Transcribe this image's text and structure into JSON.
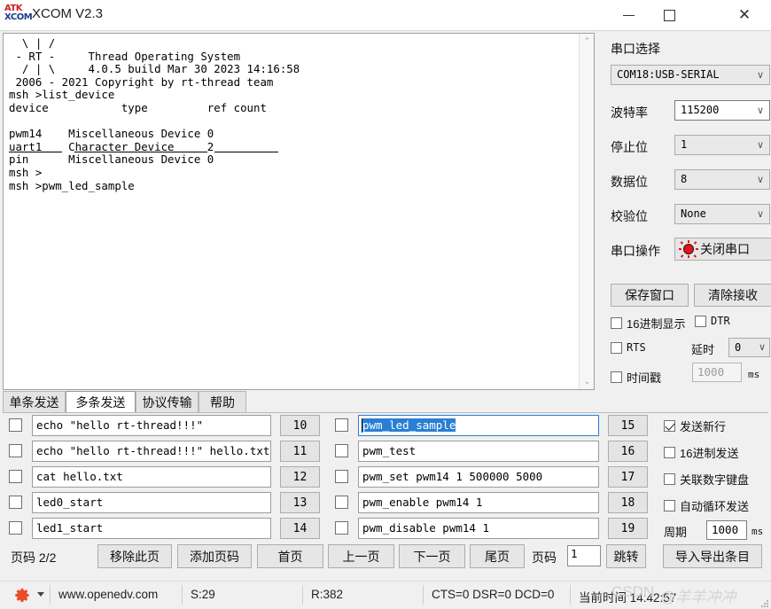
{
  "window": {
    "title": "XCOM V2.3",
    "logo_line1": "ATK",
    "logo_line2": "XCOM",
    "minimize_label": "—",
    "maximize_label": "☐",
    "close_label": "✕"
  },
  "terminal": {
    "text": "  \\ | /\n - RT -     Thread Operating System\n  / | \\     4.0.5 build Mar 30 2023 14:16:58\n 2006 - 2021 Copyright by rt-thread team\nmsh >list_device\ndevice           type         ref count\n\npwm14    Miscellaneous Device 0\nuart1    Character Device     2\npin      Miscellaneous Device 0\nmsh >\nmsh >pwm_led_sample",
    "scroll_up_icon": "⌃",
    "scroll_down_icon": "⌄"
  },
  "panel": {
    "port_section_label": "串口选择",
    "port_value": "COM18:USB-SERIAL",
    "fields": [
      {
        "label": "波特率",
        "value": "115200"
      },
      {
        "label": "停止位",
        "value": "1"
      },
      {
        "label": "数据位",
        "value": "8"
      },
      {
        "label": "校验位",
        "value": "None"
      }
    ],
    "operation_label": "串口操作",
    "close_port_label": "关闭串口",
    "save_window_label": "保存窗口",
    "clear_receive_label": "清除接收",
    "hex_display_label": "16进制显示",
    "hex_display_checked": false,
    "dtr_label": "DTR",
    "dtr_checked": false,
    "rts_label": "RTS",
    "rts_checked": false,
    "delay_label": "延时",
    "delay_value": "0",
    "timestamp_label": "时间戳",
    "timestamp_checked": false,
    "timestamp_value": "1000",
    "timestamp_unit": "ms",
    "chevron": "∨",
    "accent_red": "#e81313"
  },
  "tabs": [
    {
      "label": "单条发送",
      "active": false
    },
    {
      "label": "多条发送",
      "active": true
    },
    {
      "label": "协议传输",
      "active": false
    },
    {
      "label": "帮助",
      "active": false
    }
  ],
  "commands_left": [
    {
      "checked": false,
      "text": "echo \"hello rt-thread!!!\"",
      "num": "10"
    },
    {
      "checked": false,
      "text": "echo \"hello rt-thread!!!\" hello.txt",
      "num": "11"
    },
    {
      "checked": false,
      "text": "cat hello.txt",
      "num": "12"
    },
    {
      "checked": false,
      "text": "led0_start",
      "num": "13"
    },
    {
      "checked": false,
      "text": "led1_start",
      "num": "14"
    }
  ],
  "commands_right": [
    {
      "checked": false,
      "text": "pwm_led_sample",
      "num": "15",
      "focused": true,
      "selected": true
    },
    {
      "checked": false,
      "text": "pwm_test",
      "num": "16",
      "focused": false,
      "selected": false
    },
    {
      "checked": false,
      "text": "pwm_set pwm14 1 500000 5000",
      "num": "17",
      "focused": false,
      "selected": false
    },
    {
      "checked": false,
      "text": "pwm_enable pwm14 1",
      "num": "18",
      "focused": false,
      "selected": false
    },
    {
      "checked": false,
      "text": "pwm_disable pwm14 1",
      "num": "19",
      "focused": false,
      "selected": false
    }
  ],
  "send_options": [
    {
      "label": "发送新行",
      "checked": true
    },
    {
      "label": "16进制发送",
      "checked": false
    },
    {
      "label": "关联数字键盘",
      "checked": false
    },
    {
      "label": "自动循环发送",
      "checked": false
    }
  ],
  "period": {
    "label": "周期",
    "value": "1000",
    "unit": "ms"
  },
  "pager": {
    "page_label": "页码 2/2",
    "remove_page": "移除此页",
    "add_page": "添加页码",
    "first_page": "首页",
    "prev_page": "上一页",
    "next_page": "下一页",
    "last_page": "尾页",
    "goto_label": "页码",
    "goto_value": "1",
    "goto_button": "跳转",
    "import_export": "导入导出条目"
  },
  "status": {
    "site": "www.openedv.com",
    "sent": "S:29",
    "received": "R:382",
    "signals": "CTS=0 DSR=0 DCD=0",
    "time_label": "当前时间 14:42:57",
    "watermark": "CSDN",
    "watermark_user": "@羊羊冲冲"
  }
}
